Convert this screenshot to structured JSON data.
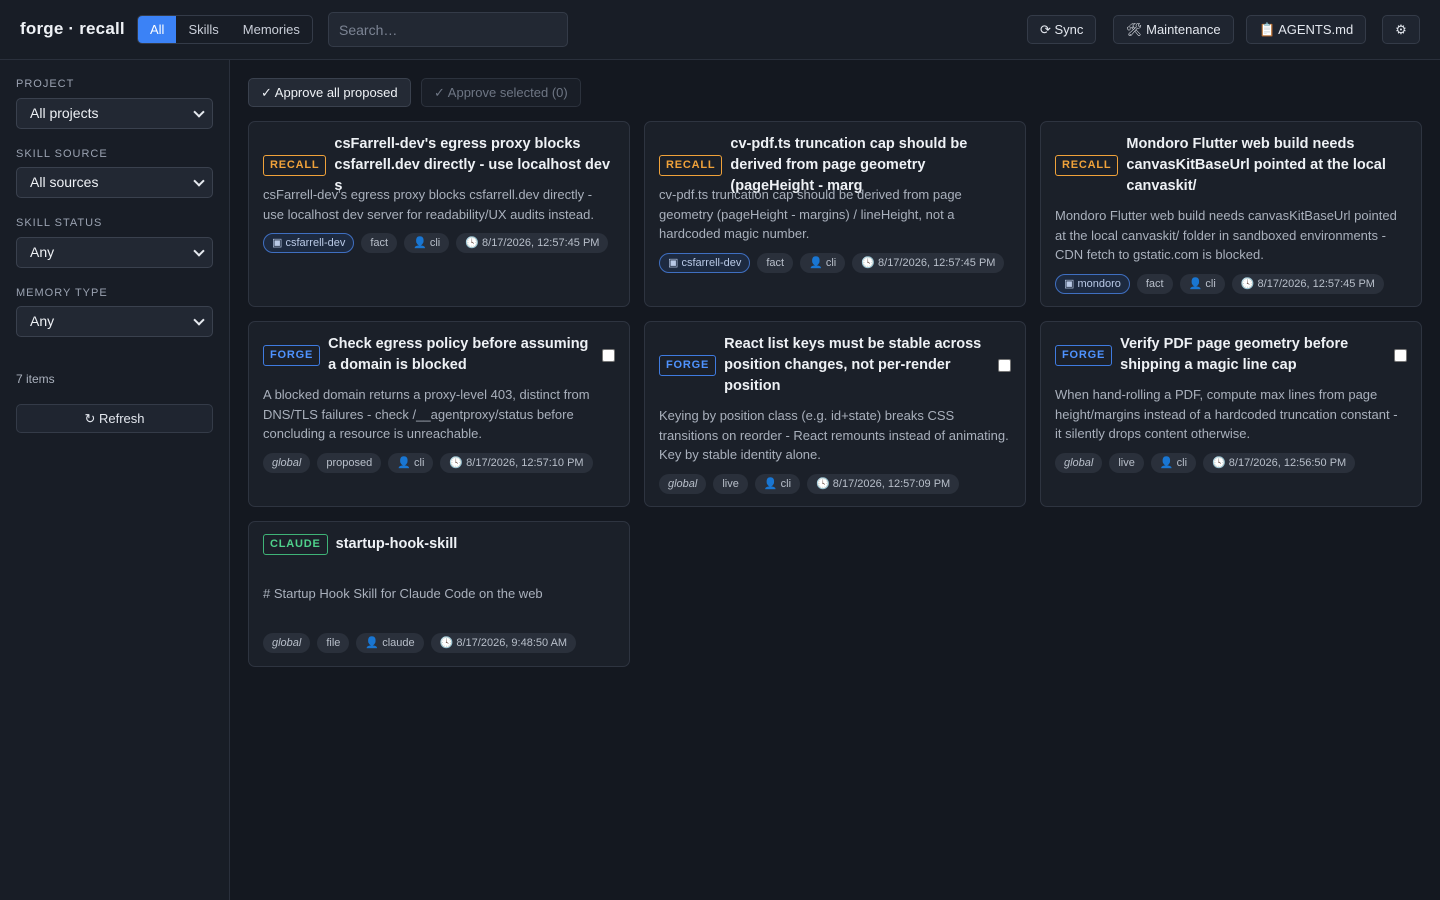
{
  "app": {
    "title": "forge · recall"
  },
  "header": {
    "tabs": [
      "All",
      "Skills",
      "Memories"
    ],
    "search_placeholder": "Search…",
    "buttons": {
      "sync": "⟳ Sync",
      "maintenance": "🛠 Maintenance",
      "agents": "📋 AGENTS.md",
      "settings": "⚙"
    }
  },
  "sidebar": {
    "filters": [
      {
        "label": "PROJECT",
        "value": "All projects"
      },
      {
        "label": "SKILL SOURCE",
        "value": "All sources"
      },
      {
        "label": "SKILL STATUS",
        "value": "Any"
      },
      {
        "label": "MEMORY TYPE",
        "value": "Any"
      }
    ],
    "items_count": "7 items",
    "refresh": "↻ Refresh"
  },
  "actions": {
    "approve_all": "✓ Approve all proposed",
    "approve_selected": "✓ Approve selected (0)"
  },
  "cards": [
    {
      "badge": "RECALL",
      "title": "csFarrell-dev's egress proxy blocks csfarrell.dev directly - use localhost dev s",
      "body": "csFarrell-dev's egress proxy blocks csfarrell.dev directly - use localhost dev server for readability/UX audits instead.",
      "tags": {
        "scope": "▣ csfarrell-dev",
        "type": "fact",
        "user": "cli",
        "time": "8/17/2026, 12:57:45 PM"
      }
    },
    {
      "badge": "RECALL",
      "title": "cv-pdf.ts truncation cap should be derived from page geometry (pageHeight - marg",
      "body": "cv-pdf.ts truncation cap should be derived from page geometry (pageHeight - margins) / lineHeight, not a hardcoded magic number.",
      "tags": {
        "scope": "▣ csfarrell-dev",
        "type": "fact",
        "user": "cli",
        "time": "8/17/2026, 12:57:45 PM"
      }
    },
    {
      "badge": "RECALL",
      "title": "Mondoro Flutter web build needs canvasKitBaseUrl pointed at the local canvaskit/",
      "body": "Mondoro Flutter web build needs canvasKitBaseUrl pointed at the local canvaskit/ folder in sandboxed environments - CDN fetch to gstatic.com is blocked.",
      "tags": {
        "scope": "▣ mondoro",
        "type": "fact",
        "user": "cli",
        "time": "8/17/2026, 12:57:45 PM"
      }
    },
    {
      "badge": "FORGE",
      "title": "Check egress policy before assuming a domain is blocked",
      "body": "A blocked domain returns a proxy-level 403, distinct from DNS/TLS failures - check /__agentproxy/status before concluding a resource is unreachable.",
      "tags": {
        "scope": "global",
        "type": "proposed",
        "user": "cli",
        "time": "8/17/2026, 12:57:10 PM"
      }
    },
    {
      "badge": "FORGE",
      "title": "React list keys must be stable across position changes, not per-render position",
      "body": "Keying by position class (e.g. id+state) breaks CSS transitions on reorder - React remounts instead of animating. Key by stable identity alone.",
      "tags": {
        "scope": "global",
        "type": "live",
        "user": "cli",
        "time": "8/17/2026, 12:57:09 PM"
      }
    },
    {
      "badge": "FORGE",
      "title": "Verify PDF page geometry before shipping a magic line cap",
      "body": "When hand-rolling a PDF, compute max lines from page height/margins instead of a hardcoded truncation constant - it silently drops content otherwise.",
      "tags": {
        "scope": "global",
        "type": "live",
        "user": "cli",
        "time": "8/17/2026, 12:56:50 PM"
      }
    },
    {
      "badge": "CLAUDE",
      "title": "startup-hook-skill",
      "body": "# Startup Hook Skill for Claude Code on the web",
      "tags": {
        "scope": "global",
        "type": "file",
        "user": "claude",
        "time": "8/17/2026, 9:48:50 AM"
      }
    }
  ]
}
